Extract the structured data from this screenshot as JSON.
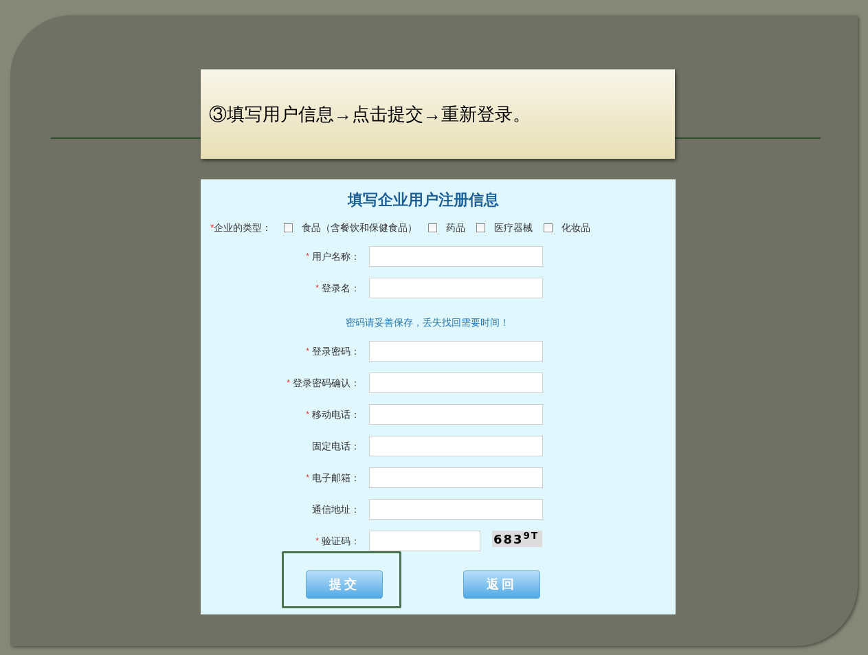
{
  "slide": {
    "caption": "③填写用户信息→点击提交→重新登录。"
  },
  "form": {
    "title": "填写企业用户注册信息",
    "type_field": {
      "mark": "*",
      "label": "企业的类型：",
      "options": [
        {
          "label": "食品（含餐饮和保健食品）",
          "checked": false
        },
        {
          "label": "药品",
          "checked": false
        },
        {
          "label": "医疗器械",
          "checked": false
        },
        {
          "label": "化妆品",
          "checked": false
        }
      ]
    },
    "fields": [
      {
        "kind": "text",
        "mark": "*",
        "label": "用户名称："
      },
      {
        "kind": "text",
        "mark": "*",
        "label": "登录名："
      },
      {
        "kind": "note",
        "text": "密码请妥善保存，丢失找回需要时间！"
      },
      {
        "kind": "text",
        "mark": "*",
        "label": "登录密码："
      },
      {
        "kind": "text",
        "mark": "*",
        "label": "登录密码确认："
      },
      {
        "kind": "text",
        "mark": "*",
        "label": "移动电话："
      },
      {
        "kind": "text",
        "label": "固定电话："
      },
      {
        "kind": "text",
        "mark": "*",
        "label": "电子邮箱："
      },
      {
        "kind": "text",
        "label": "通信地址："
      },
      {
        "kind": "captcha",
        "mark": "*",
        "label": "验证码：",
        "captcha": "683$^{9T}$"
      }
    ],
    "buttons": [
      {
        "label": "提交",
        "highlighted": true
      },
      {
        "label": "返回",
        "highlighted": false
      }
    ]
  }
}
